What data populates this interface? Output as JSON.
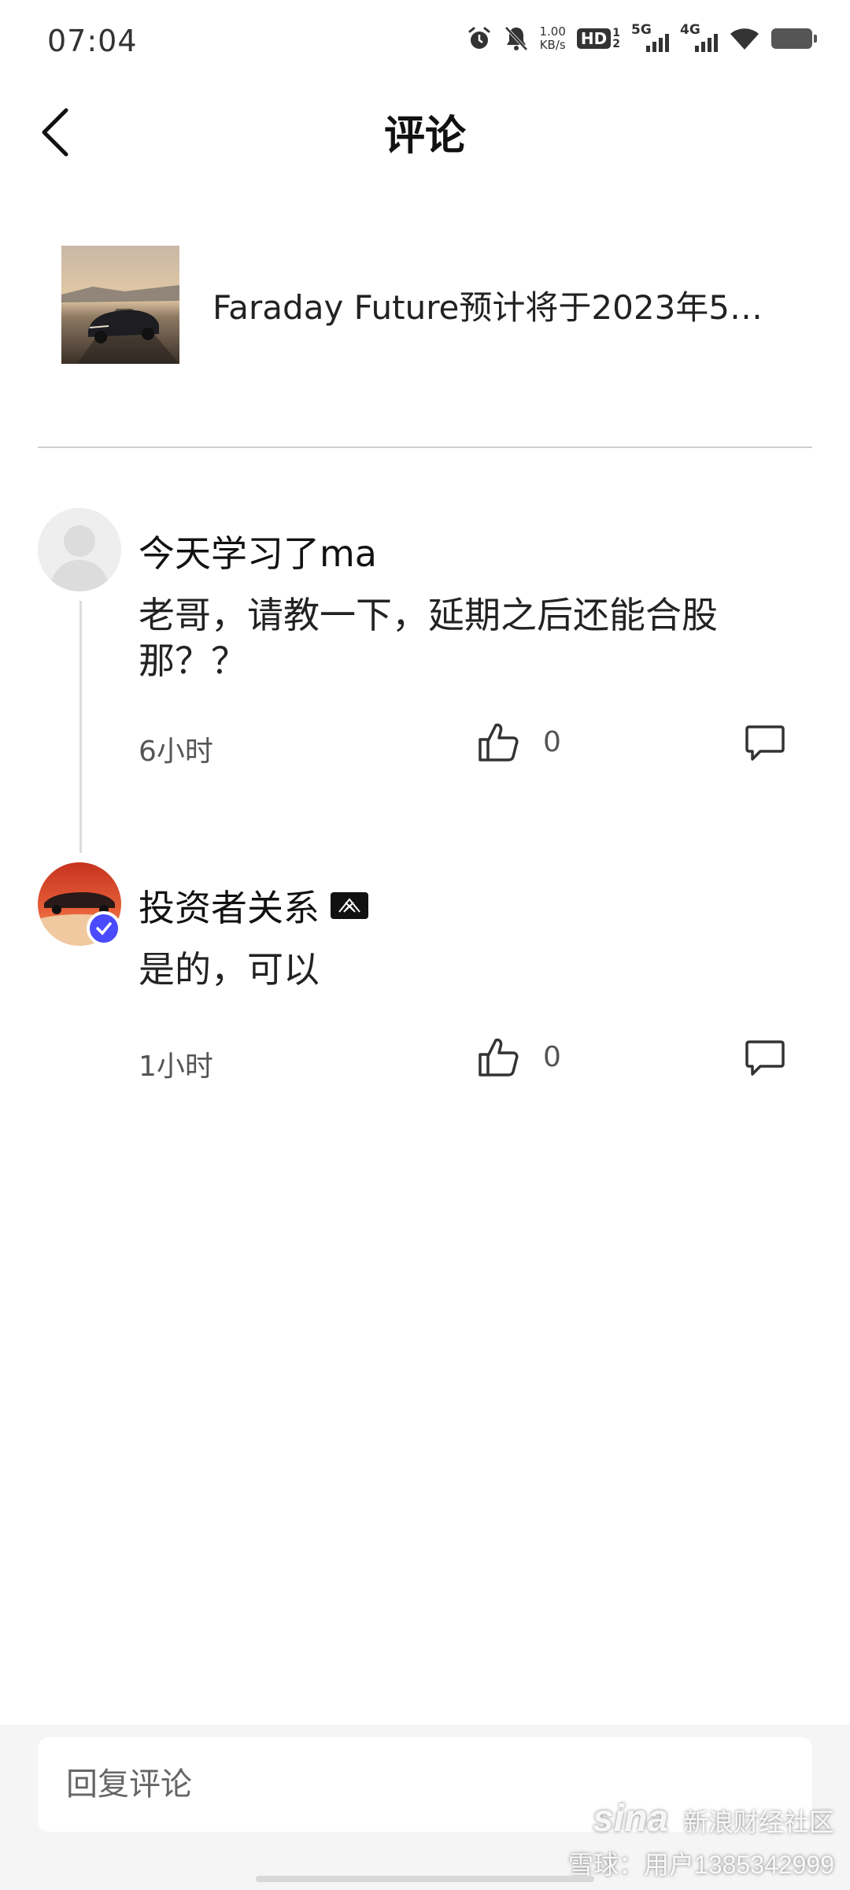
{
  "status_bar": {
    "time": "07:04",
    "net_speed_value": "1.00",
    "net_speed_unit": "KB/s",
    "hd_label": "HD",
    "hd_sim1": "1",
    "hd_sim2": "2",
    "sim1_label": "5G",
    "sim2_label": "4G",
    "icons": [
      "alarm-icon",
      "mute-icon",
      "wifi-icon",
      "battery-icon"
    ]
  },
  "header": {
    "title": "评论",
    "back_icon": "chevron-left-icon"
  },
  "article": {
    "title": "Faraday Future预计将于2023年5月…"
  },
  "comments": [
    {
      "author": "今天学习了ma",
      "text": "老哥，请教一下，延期之后还能合股那？？",
      "time": "6小时",
      "likes": "0"
    },
    {
      "author": "投资者关系",
      "text": "是的，可以",
      "time": "1小时",
      "likes": "0"
    }
  ],
  "reply_input": {
    "placeholder": "回复评论"
  },
  "watermark": {
    "brand": "sina",
    "line1": "新浪财经社区",
    "line2": "雪球：用户1385342999"
  },
  "colors": {
    "background": "#ffffff",
    "bottom_bar": "#f5f5f5",
    "verified_badge": "#4a4aff"
  }
}
